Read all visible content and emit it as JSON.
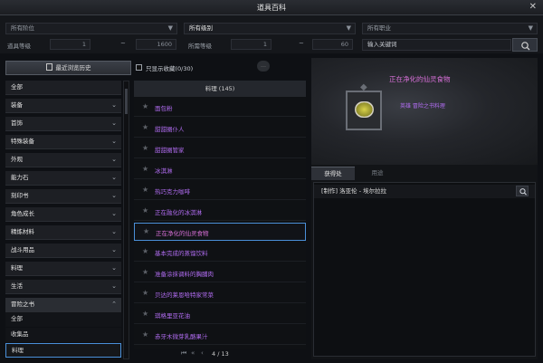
{
  "window": {
    "title": "道具百科",
    "close": "✕"
  },
  "filters": {
    "grade": "所有阶位",
    "level": "所有级别",
    "class": "所有职业",
    "item_level_label": "道具等级",
    "item_level_min": "1",
    "item_level_max": "1600",
    "use_level_label": "所需等级",
    "use_level_min": "1",
    "use_level_max": "60",
    "tilde": "~",
    "keyword_placeholder": "输入关键词",
    "arrow": "▼"
  },
  "history_button": "最近浏览历史",
  "favorites_toggle": "只显示收藏(0/30)",
  "categories": [
    {
      "label": "全部",
      "chev": ""
    },
    {
      "label": "装备",
      "chev": "⌄"
    },
    {
      "label": "首饰",
      "chev": "⌄"
    },
    {
      "label": "特殊装备",
      "chev": "⌄"
    },
    {
      "label": "外观",
      "chev": "⌄"
    },
    {
      "label": "能力石",
      "chev": "⌄"
    },
    {
      "label": "刻印书",
      "chev": "⌄"
    },
    {
      "label": "角色成长",
      "chev": "⌄"
    },
    {
      "label": "精炼材料",
      "chev": "⌄"
    },
    {
      "label": "战斗用品",
      "chev": "⌄"
    },
    {
      "label": "料理",
      "chev": "⌄"
    },
    {
      "label": "生活",
      "chev": "⌄"
    },
    {
      "label": "冒险之书",
      "chev": "⌃"
    }
  ],
  "subcategories": [
    {
      "label": "全部"
    },
    {
      "label": "收集品"
    },
    {
      "label": "料理"
    }
  ],
  "list": {
    "header": "料理 (145)",
    "items": [
      {
        "name": "面包粉"
      },
      {
        "name": "甜甜圈仆人"
      },
      {
        "name": "甜甜圈管家"
      },
      {
        "name": "冰淇淋"
      },
      {
        "name": "热巧克力咖啡"
      },
      {
        "name": "正在融化的冰淇淋"
      },
      {
        "name": "正在净化的仙灵食物"
      },
      {
        "name": "基本完成的蒸馏饮料"
      },
      {
        "name": "准备涂抹调料的胸脯肉"
      },
      {
        "name": "贝达的莱恩哈特家常菜"
      },
      {
        "name": "琪格里亚花油"
      },
      {
        "name": "赤牙木微芽乳酪果汁"
      }
    ],
    "star": "★",
    "pager": {
      "first": "⏮",
      "prev2": "«",
      "prev": "‹",
      "page": "4 / 13"
    }
  },
  "detail": {
    "name": "正在净化的仙灵食物",
    "type": "英雄 冒险之书料理",
    "tabs": [
      "获得处",
      "用途"
    ],
    "sources": [
      {
        "text": "[制作] 洛亚伦 - 埃尔拉拉"
      }
    ]
  }
}
